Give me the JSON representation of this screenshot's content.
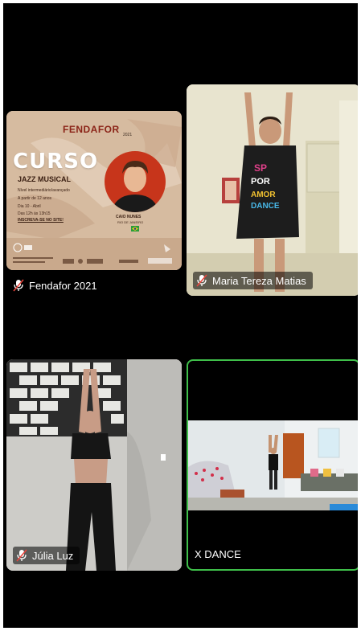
{
  "tiles": [
    {
      "name": "Fendafor 2021",
      "muted": true,
      "poster": {
        "brand": "FENDAFOR",
        "year": "2021",
        "title": "CURSO",
        "subtitle": "JAZZ MUSICAL",
        "info": [
          "Nível intermediário/avançado",
          "A partir de 12 anos",
          "Dia 10 - Abril",
          "Das 12h às 13h15"
        ],
        "cta": "INSCREVA-SE NO SITE!",
        "teacher": "CAIO NUNES",
        "city": "RIO DE JANEIRO"
      }
    },
    {
      "name": "Maria Tereza Matias",
      "muted": true
    },
    {
      "name": "Júlia Luz",
      "muted": true
    },
    {
      "name": "X DANCE",
      "muted": false,
      "active_speaker": true
    }
  ],
  "colors": {
    "active_border": "#3fbf4a",
    "background": "#000000"
  },
  "icons": {
    "muted": "mic-off-icon"
  }
}
